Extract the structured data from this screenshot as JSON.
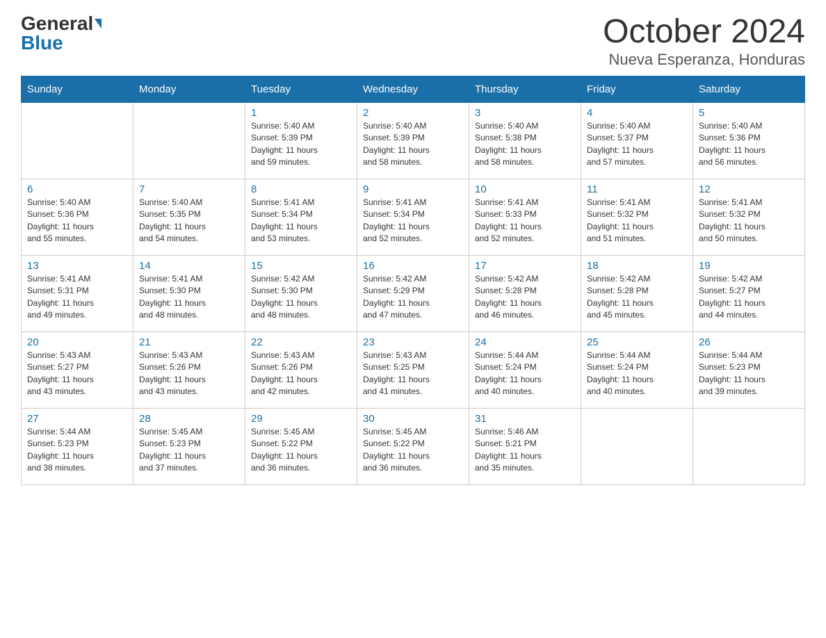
{
  "logo": {
    "general": "General",
    "blue": "Blue"
  },
  "title": "October 2024",
  "subtitle": "Nueva Esperanza, Honduras",
  "days_of_week": [
    "Sunday",
    "Monday",
    "Tuesday",
    "Wednesday",
    "Thursday",
    "Friday",
    "Saturday"
  ],
  "weeks": [
    [
      {
        "day": "",
        "info": ""
      },
      {
        "day": "",
        "info": ""
      },
      {
        "day": "1",
        "info": "Sunrise: 5:40 AM\nSunset: 5:39 PM\nDaylight: 11 hours\nand 59 minutes."
      },
      {
        "day": "2",
        "info": "Sunrise: 5:40 AM\nSunset: 5:39 PM\nDaylight: 11 hours\nand 58 minutes."
      },
      {
        "day": "3",
        "info": "Sunrise: 5:40 AM\nSunset: 5:38 PM\nDaylight: 11 hours\nand 58 minutes."
      },
      {
        "day": "4",
        "info": "Sunrise: 5:40 AM\nSunset: 5:37 PM\nDaylight: 11 hours\nand 57 minutes."
      },
      {
        "day": "5",
        "info": "Sunrise: 5:40 AM\nSunset: 5:36 PM\nDaylight: 11 hours\nand 56 minutes."
      }
    ],
    [
      {
        "day": "6",
        "info": "Sunrise: 5:40 AM\nSunset: 5:36 PM\nDaylight: 11 hours\nand 55 minutes."
      },
      {
        "day": "7",
        "info": "Sunrise: 5:40 AM\nSunset: 5:35 PM\nDaylight: 11 hours\nand 54 minutes."
      },
      {
        "day": "8",
        "info": "Sunrise: 5:41 AM\nSunset: 5:34 PM\nDaylight: 11 hours\nand 53 minutes."
      },
      {
        "day": "9",
        "info": "Sunrise: 5:41 AM\nSunset: 5:34 PM\nDaylight: 11 hours\nand 52 minutes."
      },
      {
        "day": "10",
        "info": "Sunrise: 5:41 AM\nSunset: 5:33 PM\nDaylight: 11 hours\nand 52 minutes."
      },
      {
        "day": "11",
        "info": "Sunrise: 5:41 AM\nSunset: 5:32 PM\nDaylight: 11 hours\nand 51 minutes."
      },
      {
        "day": "12",
        "info": "Sunrise: 5:41 AM\nSunset: 5:32 PM\nDaylight: 11 hours\nand 50 minutes."
      }
    ],
    [
      {
        "day": "13",
        "info": "Sunrise: 5:41 AM\nSunset: 5:31 PM\nDaylight: 11 hours\nand 49 minutes."
      },
      {
        "day": "14",
        "info": "Sunrise: 5:41 AM\nSunset: 5:30 PM\nDaylight: 11 hours\nand 48 minutes."
      },
      {
        "day": "15",
        "info": "Sunrise: 5:42 AM\nSunset: 5:30 PM\nDaylight: 11 hours\nand 48 minutes."
      },
      {
        "day": "16",
        "info": "Sunrise: 5:42 AM\nSunset: 5:29 PM\nDaylight: 11 hours\nand 47 minutes."
      },
      {
        "day": "17",
        "info": "Sunrise: 5:42 AM\nSunset: 5:28 PM\nDaylight: 11 hours\nand 46 minutes."
      },
      {
        "day": "18",
        "info": "Sunrise: 5:42 AM\nSunset: 5:28 PM\nDaylight: 11 hours\nand 45 minutes."
      },
      {
        "day": "19",
        "info": "Sunrise: 5:42 AM\nSunset: 5:27 PM\nDaylight: 11 hours\nand 44 minutes."
      }
    ],
    [
      {
        "day": "20",
        "info": "Sunrise: 5:43 AM\nSunset: 5:27 PM\nDaylight: 11 hours\nand 43 minutes."
      },
      {
        "day": "21",
        "info": "Sunrise: 5:43 AM\nSunset: 5:26 PM\nDaylight: 11 hours\nand 43 minutes."
      },
      {
        "day": "22",
        "info": "Sunrise: 5:43 AM\nSunset: 5:26 PM\nDaylight: 11 hours\nand 42 minutes."
      },
      {
        "day": "23",
        "info": "Sunrise: 5:43 AM\nSunset: 5:25 PM\nDaylight: 11 hours\nand 41 minutes."
      },
      {
        "day": "24",
        "info": "Sunrise: 5:44 AM\nSunset: 5:24 PM\nDaylight: 11 hours\nand 40 minutes."
      },
      {
        "day": "25",
        "info": "Sunrise: 5:44 AM\nSunset: 5:24 PM\nDaylight: 11 hours\nand 40 minutes."
      },
      {
        "day": "26",
        "info": "Sunrise: 5:44 AM\nSunset: 5:23 PM\nDaylight: 11 hours\nand 39 minutes."
      }
    ],
    [
      {
        "day": "27",
        "info": "Sunrise: 5:44 AM\nSunset: 5:23 PM\nDaylight: 11 hours\nand 38 minutes."
      },
      {
        "day": "28",
        "info": "Sunrise: 5:45 AM\nSunset: 5:23 PM\nDaylight: 11 hours\nand 37 minutes."
      },
      {
        "day": "29",
        "info": "Sunrise: 5:45 AM\nSunset: 5:22 PM\nDaylight: 11 hours\nand 36 minutes."
      },
      {
        "day": "30",
        "info": "Sunrise: 5:45 AM\nSunset: 5:22 PM\nDaylight: 11 hours\nand 36 minutes."
      },
      {
        "day": "31",
        "info": "Sunrise: 5:46 AM\nSunset: 5:21 PM\nDaylight: 11 hours\nand 35 minutes."
      },
      {
        "day": "",
        "info": ""
      },
      {
        "day": "",
        "info": ""
      }
    ]
  ]
}
